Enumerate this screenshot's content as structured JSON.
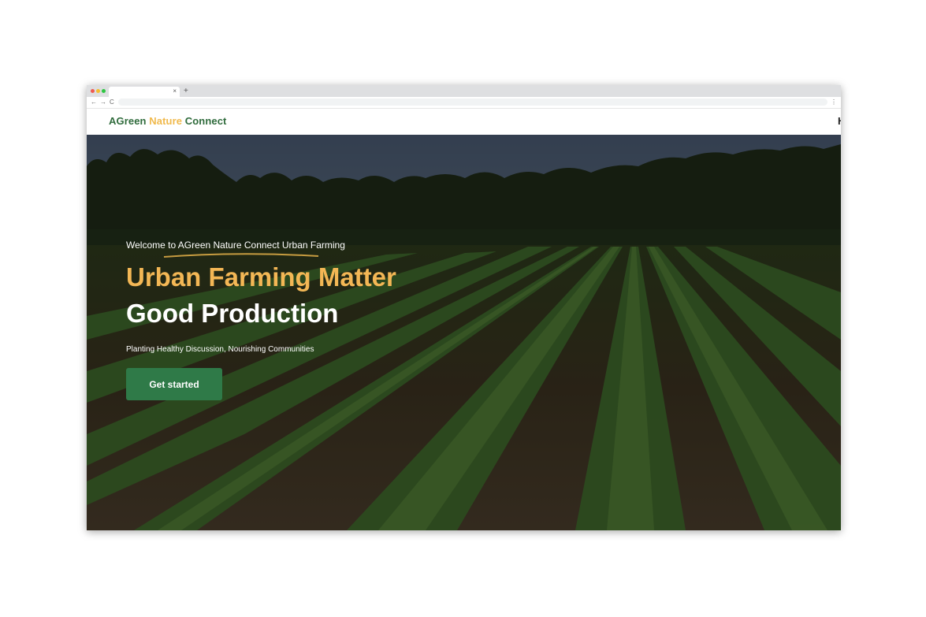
{
  "browser": {
    "tab_close": "×",
    "new_tab": "+",
    "nav_back": "←",
    "nav_forward": "→",
    "nav_reload": "C",
    "menu": "⋮",
    "url": ""
  },
  "header": {
    "logo_part1": "AGreen",
    "logo_part2": "Nature",
    "logo_part3": "Connect",
    "nav_link": "H"
  },
  "hero": {
    "welcome": "Welcome to AGreen Nature Connect Urban Farming",
    "title_line1": "Urban Farming Matter",
    "title_line2": "Good Production",
    "subtitle": "Planting Healthy Discussion, Nourishing Communities",
    "cta_label": "Get started"
  },
  "colors": {
    "brand_green": "#2f6b3c",
    "brand_yellow": "#f0b94c",
    "button_green": "#2f7a48",
    "title_yellow": "#f3b755"
  }
}
